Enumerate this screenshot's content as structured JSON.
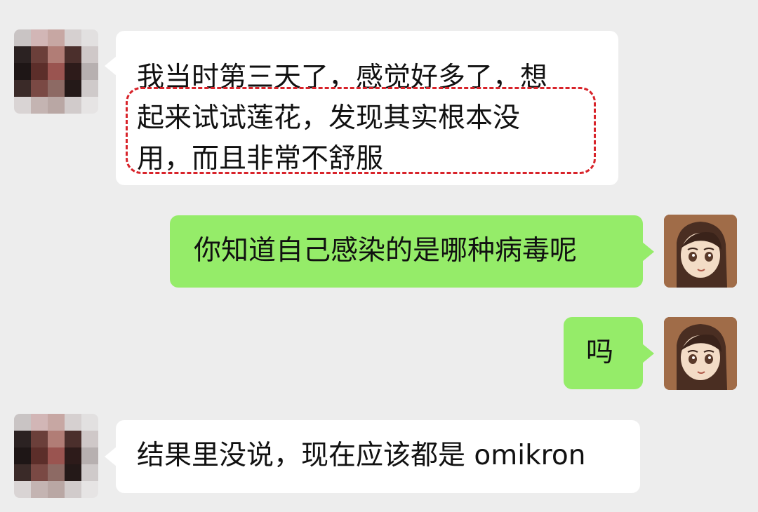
{
  "messages": [
    {
      "side": "incoming",
      "lines": [
        "我当时第三天了，感觉好多了，想",
        "起来试试莲花，发现其实根本没",
        "用，而且非常不舒服"
      ],
      "highlighted": true,
      "avatar": "pixelated-avatar"
    },
    {
      "side": "outgoing",
      "text": "你知道自己感染的是哪种病毒呢",
      "avatar": "anime-girl-avatar"
    },
    {
      "side": "outgoing",
      "text": "吗",
      "avatar": "anime-girl-avatar"
    },
    {
      "side": "incoming",
      "text": "结果里没说，现在应该都是 omikron",
      "avatar": "pixelated-avatar"
    }
  ],
  "colors": {
    "background": "#ededed",
    "incoming_bubble": "#ffffff",
    "outgoing_bubble": "#95ec69",
    "highlight_border": "#d8232a"
  }
}
